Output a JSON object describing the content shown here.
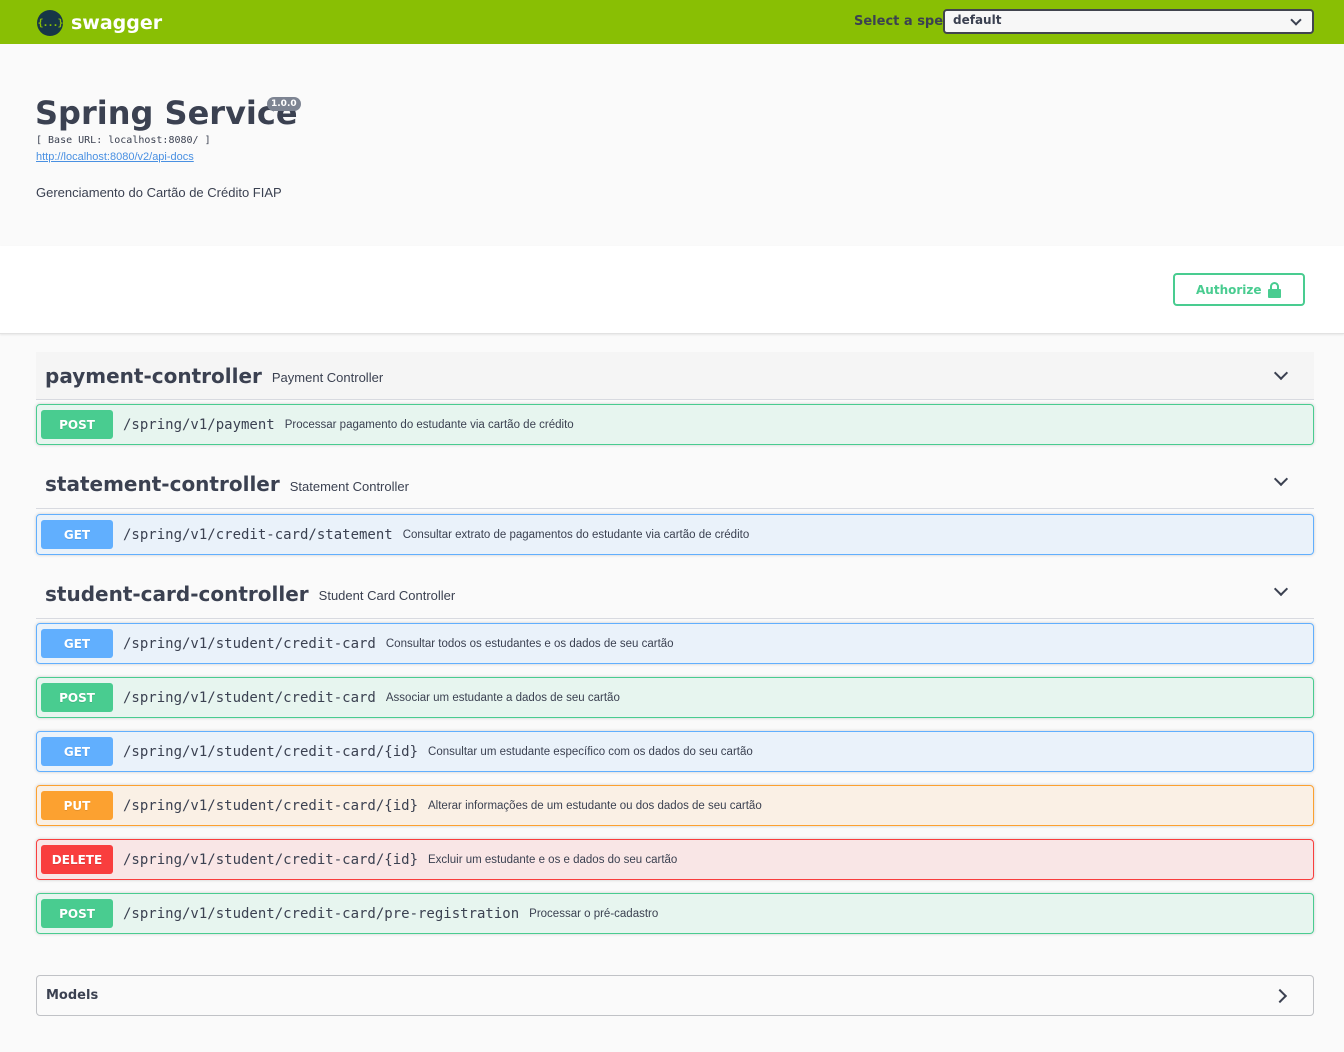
{
  "topbar": {
    "logo_glyph": "{...}",
    "logo_text": "swagger",
    "spec_label": "Select a spec",
    "spec_value": "default",
    "background": "#89bf04"
  },
  "info": {
    "title": "Spring Service",
    "version": "1.0.0",
    "base_url": "[ Base URL: localhost:8080/ ]",
    "api_docs_link": "http://localhost:8080/v2/api-docs",
    "description": "Gerenciamento do Cartão de Crédito FIAP"
  },
  "authorize": {
    "label": "Authorize",
    "icon": "lock-icon",
    "color": "#49cc90"
  },
  "tags": [
    {
      "name": "payment-controller",
      "description": "Payment Controller",
      "operations": [
        {
          "method": "POST",
          "path": "/spring/v1/payment",
          "summary": "Processar pagamento do estudante via cartão de crédito"
        }
      ]
    },
    {
      "name": "statement-controller",
      "description": "Statement Controller",
      "operations": [
        {
          "method": "GET",
          "path": "/spring/v1/credit-card/statement",
          "summary": "Consultar extrato de pagamentos do estudante via cartão de crédito"
        }
      ]
    },
    {
      "name": "student-card-controller",
      "description": "Student Card Controller",
      "operations": [
        {
          "method": "GET",
          "path": "/spring/v1/student/credit-card",
          "summary": "Consultar todos os estudantes e os dados de seu cartão"
        },
        {
          "method": "POST",
          "path": "/spring/v1/student/credit-card",
          "summary": "Associar um estudante a dados de seu cartão"
        },
        {
          "method": "GET",
          "path": "/spring/v1/student/credit-card/{id}",
          "summary": "Consultar um estudante específico com os dados do seu cartão"
        },
        {
          "method": "PUT",
          "path": "/spring/v1/student/credit-card/{id}",
          "summary": "Alterar informações de um estudante ou dos dados de seu cartão"
        },
        {
          "method": "DELETE",
          "path": "/spring/v1/student/credit-card/{id}",
          "summary": "Excluir um estudante e os e dados do seu cartão"
        },
        {
          "method": "POST",
          "path": "/spring/v1/student/credit-card/pre-registration",
          "summary": "Processar o pré-cadastro"
        }
      ]
    }
  ],
  "models": {
    "label": "Models"
  },
  "method_colors": {
    "POST": "#49cc90",
    "GET": "#61affe",
    "PUT": "#fca130",
    "DELETE": "#f93e3e"
  }
}
